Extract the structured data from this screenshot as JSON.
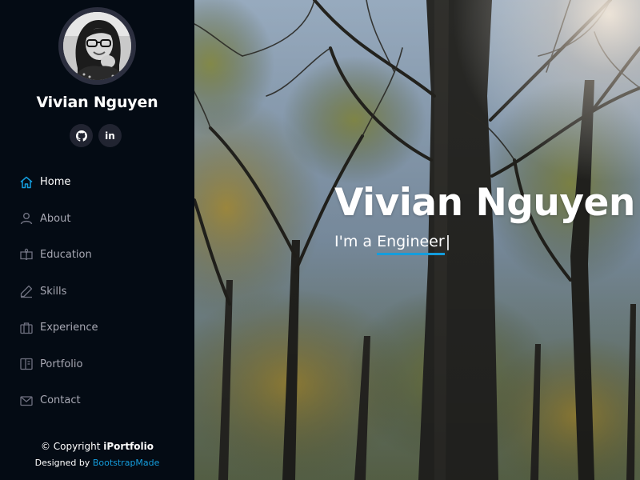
{
  "profile": {
    "name": "Vivian Nguyen",
    "avatar_icon": "profile-photo"
  },
  "social": [
    {
      "name": "github",
      "icon": "github-icon"
    },
    {
      "name": "linkedin",
      "icon": "linkedin-icon",
      "text": "in"
    }
  ],
  "nav": {
    "items": [
      {
        "label": "Home",
        "icon": "home-icon",
        "active": true
      },
      {
        "label": "About",
        "icon": "user-icon"
      },
      {
        "label": "Education",
        "icon": "book-icon"
      },
      {
        "label": "Skills",
        "icon": "pencil-icon"
      },
      {
        "label": "Experience",
        "icon": "briefcase-icon"
      },
      {
        "label": "Portfolio",
        "icon": "portfolio-icon"
      },
      {
        "label": "Contact",
        "icon": "envelope-icon"
      }
    ]
  },
  "footer": {
    "copyright_prefix": "© Copyright ",
    "copyright_brand": "iPortfolio",
    "credits_prefix": "Designed by ",
    "credits_link": "BootstrapMade"
  },
  "hero": {
    "title": "Vivian Nguyen",
    "subtitle_prefix": "I'm a ",
    "typed_word": "Engineer",
    "cursor": "|"
  },
  "colors": {
    "sidebar_bg": "#040b14",
    "accent": "#149ddd",
    "nav_text": "#a8a9b4",
    "social_bg": "#212431"
  }
}
